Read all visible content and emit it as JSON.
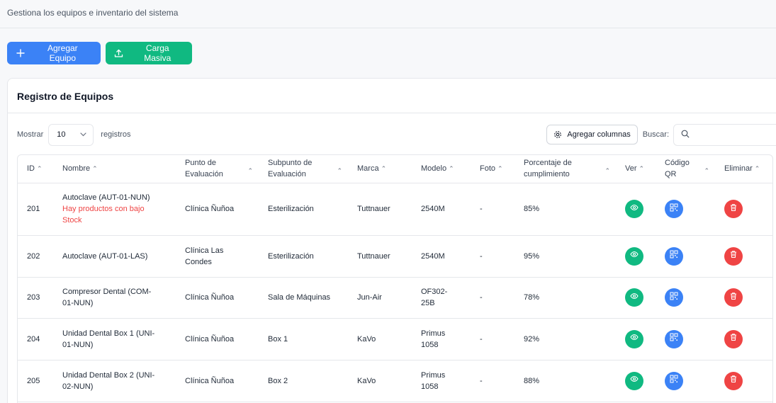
{
  "header": {
    "subtitle": "Gestiona los equipos e inventario del sistema"
  },
  "actions": {
    "add_label": "Agregar Equipo",
    "bulk_label": "Carga Masiva"
  },
  "card": {
    "title": "Registro de Equipos"
  },
  "controls": {
    "show_label": "Mostrar",
    "page_size": "10",
    "records_label": "registros",
    "add_columns_label": "Agregar columnas",
    "search_label": "Buscar:",
    "search_value": ""
  },
  "table": {
    "headers": {
      "id": "ID",
      "nombre": "Nombre",
      "punto": "Punto de Evaluación",
      "subpunto": "Subpunto de Evaluación",
      "marca": "Marca",
      "modelo": "Modelo",
      "foto": "Foto",
      "porcentaje": "Porcentaje de cumplimiento",
      "ver": "Ver",
      "qr": "Código QR",
      "eliminar": "Eliminar"
    },
    "rows": [
      {
        "id": "201",
        "nombre": "Autoclave (AUT-01-NUN)",
        "warning": "Hay productos con bajo Stock",
        "punto": "Clínica Ñuñoa",
        "subpunto": "Esterilización",
        "marca": "Tuttnauer",
        "modelo": "2540M",
        "foto": "-",
        "porcentaje": "85%"
      },
      {
        "id": "202",
        "nombre": "Autoclave (AUT-01-LAS)",
        "warning": "",
        "punto": "Clínica Las Condes",
        "subpunto": "Esterilización",
        "marca": "Tuttnauer",
        "modelo": "2540M",
        "foto": "-",
        "porcentaje": "95%"
      },
      {
        "id": "203",
        "nombre": "Compresor Dental (COM-01-NUN)",
        "warning": "",
        "punto": "Clínica Ñuñoa",
        "subpunto": "Sala de Máquinas",
        "marca": "Jun-Air",
        "modelo": "OF302-25B",
        "foto": "-",
        "porcentaje": "78%"
      },
      {
        "id": "204",
        "nombre": "Unidad Dental Box 1 (UNI-01-NUN)",
        "warning": "",
        "punto": "Clínica Ñuñoa",
        "subpunto": "Box 1",
        "marca": "KaVo",
        "modelo": "Primus 1058",
        "foto": "-",
        "porcentaje": "92%"
      },
      {
        "id": "205",
        "nombre": "Unidad Dental Box 2 (UNI-02-NUN)",
        "warning": "",
        "punto": "Clínica Ñuñoa",
        "subpunto": "Box 2",
        "marca": "KaVo",
        "modelo": "Primus 1058",
        "foto": "-",
        "porcentaje": "88%"
      }
    ]
  },
  "icons": {
    "add": "plus-icon",
    "bulk": "upload-icon",
    "columns": "gear-icon",
    "search": "search-icon",
    "view": "eye-icon",
    "qr": "qr-code-icon",
    "delete": "trash-icon"
  },
  "colors": {
    "primary": "#3b82f6",
    "success": "#10b981",
    "danger": "#ef4444"
  }
}
